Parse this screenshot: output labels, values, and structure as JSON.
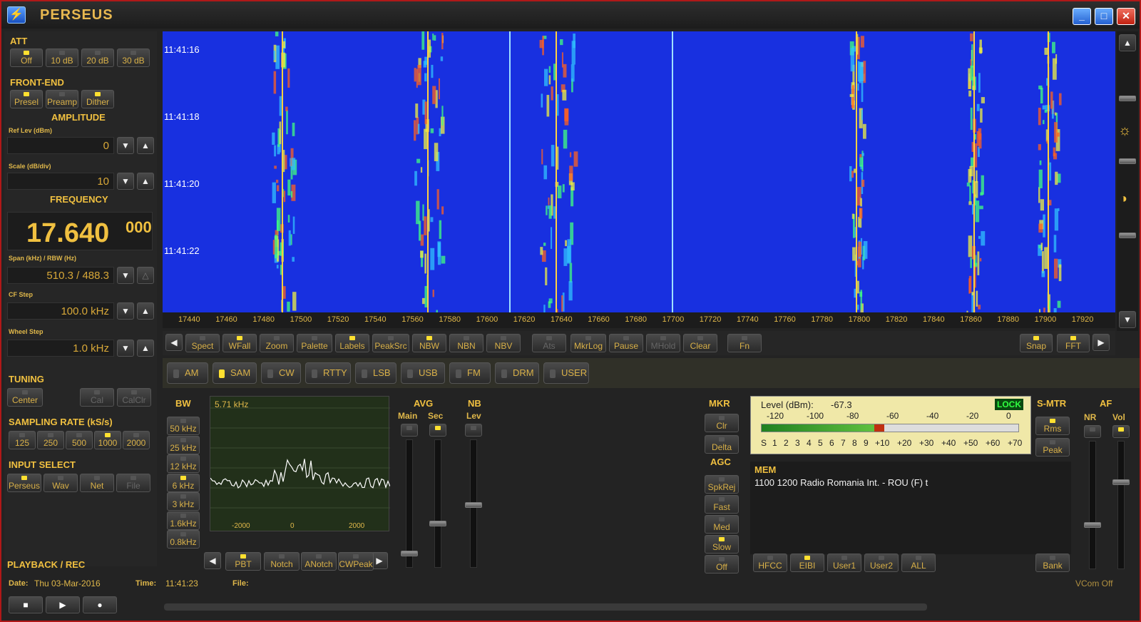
{
  "app": {
    "title": "PERSEUS"
  },
  "att": {
    "title": "ATT",
    "buttons": [
      {
        "label": "Off",
        "on": true
      },
      {
        "label": "10 dB",
        "on": false
      },
      {
        "label": "20 dB",
        "on": false
      },
      {
        "label": "30 dB",
        "on": false
      }
    ]
  },
  "frontend": {
    "title": "FRONT-END",
    "buttons": [
      {
        "label": "Presel",
        "on": true
      },
      {
        "label": "Preamp",
        "on": false
      },
      {
        "label": "Dither",
        "on": true
      }
    ]
  },
  "amplitude": {
    "title": "AMPLITUDE",
    "ref_label": "Ref Lev (dBm)",
    "ref_value": "0",
    "scale_label": "Scale (dB/div)",
    "scale_value": "10"
  },
  "frequency": {
    "title": "FREQUENCY",
    "main": "17.640",
    "sub": "000",
    "span_label": "Span (kHz) / RBW (Hz)",
    "span_value": "510.3 / 488.3",
    "cfstep_label": "CF Step",
    "cfstep_value": "100.0 kHz",
    "wheel_label": "Wheel Step",
    "wheel_value": "1.0 kHz"
  },
  "tuning": {
    "title": "TUNING",
    "center": "Center",
    "cal": "Cal",
    "calclr": "CalClr"
  },
  "sampling": {
    "title": "SAMPLING RATE (kS/s)",
    "buttons": [
      {
        "label": "125",
        "on": false
      },
      {
        "label": "250",
        "on": false
      },
      {
        "label": "500",
        "on": false
      },
      {
        "label": "1000",
        "on": true
      },
      {
        "label": "2000",
        "on": false
      }
    ]
  },
  "input": {
    "title": "INPUT SELECT",
    "buttons": [
      {
        "label": "Perseus",
        "on": true
      },
      {
        "label": "Wav",
        "on": false
      },
      {
        "label": "Net",
        "on": false
      },
      {
        "label": "File",
        "on": false
      }
    ]
  },
  "playback": {
    "title": "PLAYBACK / REC"
  },
  "waterfall": {
    "times": [
      "11:41:16",
      "11:41:18",
      "11:41:20",
      "11:41:22"
    ],
    "axis": [
      "17440",
      "17460",
      "17480",
      "17500",
      "17520",
      "17540",
      "17560",
      "17580",
      "17600",
      "17620",
      "17640",
      "17660",
      "17680",
      "17700",
      "17720",
      "17740",
      "17760",
      "17780",
      "17800",
      "17820",
      "17840",
      "17860",
      "17880",
      "17900",
      "17920"
    ]
  },
  "toolbar": {
    "buttons": [
      {
        "label": "Spect",
        "on": false
      },
      {
        "label": "WFall",
        "on": true
      },
      {
        "label": "Zoom",
        "on": false
      },
      {
        "label": "Palette",
        "on": false
      },
      {
        "label": "Labels",
        "on": true
      },
      {
        "label": "PeakSrc",
        "on": false
      },
      {
        "label": "NBW",
        "on": true
      },
      {
        "label": "NBN",
        "on": false
      },
      {
        "label": "NBV",
        "on": false
      },
      {
        "label": "Ats",
        "on": false
      },
      {
        "label": "MkrLog",
        "on": false
      },
      {
        "label": "Pause",
        "on": false
      },
      {
        "label": "MHold",
        "on": false
      },
      {
        "label": "Clear",
        "on": false
      },
      {
        "label": "Fn",
        "on": false
      }
    ],
    "snap": "Snap",
    "fft": "FFT"
  },
  "modes": [
    {
      "label": "AM",
      "on": false
    },
    {
      "label": "SAM",
      "on": true
    },
    {
      "label": "CW",
      "on": false
    },
    {
      "label": "RTTY",
      "on": false
    },
    {
      "label": "LSB",
      "on": false
    },
    {
      "label": "USB",
      "on": false
    },
    {
      "label": "FM",
      "on": false
    },
    {
      "label": "DRM",
      "on": false
    },
    {
      "label": "USER",
      "on": false
    }
  ],
  "bw": {
    "title": "BW",
    "value": "5.71 kHz",
    "buttons": [
      {
        "label": "50 kHz",
        "on": false
      },
      {
        "label": "25 kHz",
        "on": false
      },
      {
        "label": "12 kHz",
        "on": false
      },
      {
        "label": "6 kHz",
        "on": true
      },
      {
        "label": "3 kHz",
        "on": false
      },
      {
        "label": "1.6kHz",
        "on": false
      },
      {
        "label": "0.8kHz",
        "on": false
      }
    ],
    "axis": [
      "-2000",
      "0",
      "2000"
    ],
    "bottom": [
      {
        "label": "PBT",
        "on": true
      },
      {
        "label": "Notch",
        "on": false
      },
      {
        "label": "ANotch",
        "on": false
      },
      {
        "label": "CWPeak",
        "on": false
      }
    ]
  },
  "avg": {
    "title": "AVG",
    "main": "Main",
    "sec": "Sec"
  },
  "nb": {
    "title": "NB",
    "lev": "Lev"
  },
  "mkr": {
    "title": "MKR",
    "clr": "Clr",
    "delta": "Delta"
  },
  "agc": {
    "title": "AGC",
    "buttons": [
      {
        "label": "SpkRej",
        "on": false
      },
      {
        "label": "Fast",
        "on": false
      },
      {
        "label": "Med",
        "on": false
      },
      {
        "label": "Slow",
        "on": true
      },
      {
        "label": "Off",
        "on": false
      }
    ]
  },
  "meter": {
    "level_label": "Level (dBm):",
    "level_value": "-67.3",
    "lock": "LOCK",
    "scale_top": [
      "-120",
      "-100",
      "-80",
      "-60",
      "-40",
      "-20",
      "0"
    ],
    "scale_bottom": [
      "S",
      "1",
      "2",
      "3",
      "4",
      "5",
      "6",
      "7",
      "8",
      "9",
      "+10",
      "+20",
      "+30",
      "+40",
      "+50",
      "+60",
      "+70"
    ],
    "level_fraction": 0.44
  },
  "smtr": {
    "title": "S-MTR",
    "rms": "Rms",
    "peak": "Peak"
  },
  "af": {
    "title": "AF",
    "nr": "NR",
    "vol": "Vol"
  },
  "mem": {
    "title": "MEM",
    "entry": "1100 1200 Radio Romania Int.  - ROU (F)  t",
    "buttons": [
      {
        "label": "HFCC",
        "on": false
      },
      {
        "label": "EIBI",
        "on": true
      },
      {
        "label": "User1",
        "on": false
      },
      {
        "label": "User2",
        "on": false
      },
      {
        "label": "ALL",
        "on": false
      }
    ],
    "bank": "Bank"
  },
  "status": {
    "date_label": "Date:",
    "date_value": "Thu 03-Mar-2016",
    "time_label": "Time:",
    "time_value": "11:41:23",
    "file_label": "File:",
    "vcom": "VCom Off"
  }
}
